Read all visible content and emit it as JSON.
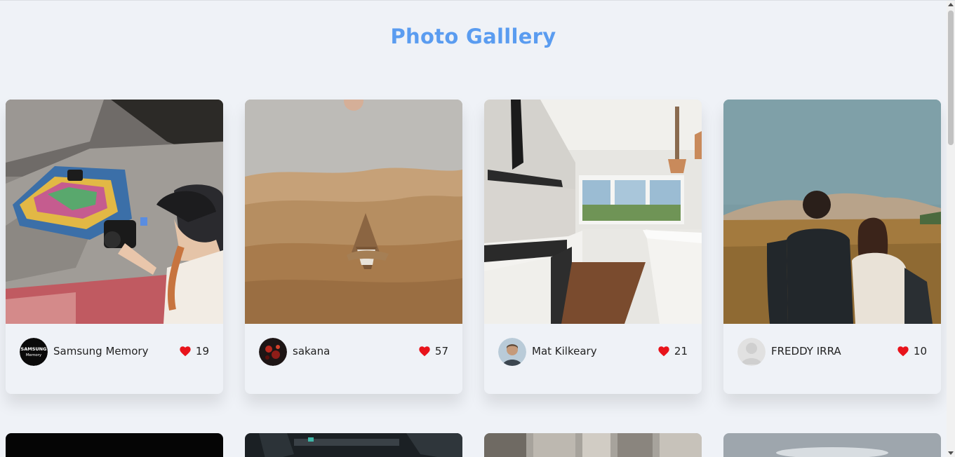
{
  "page": {
    "title": "Photo Galllery"
  },
  "photos": [
    {
      "author": "Samsung Memory",
      "likes": "19",
      "avatar_text_1": "SAMSUNG",
      "avatar_text_2": "Memory"
    },
    {
      "author": "sakana",
      "likes": "57"
    },
    {
      "author": "Mat Kilkeary",
      "likes": "21"
    },
    {
      "author": "FREDDY IRRA",
      "likes": "10"
    }
  ],
  "colors": {
    "title": "#5a9cf0",
    "heart": "#e8131b",
    "background": "#eff2f7"
  },
  "icons": {
    "like": "heart-icon"
  }
}
